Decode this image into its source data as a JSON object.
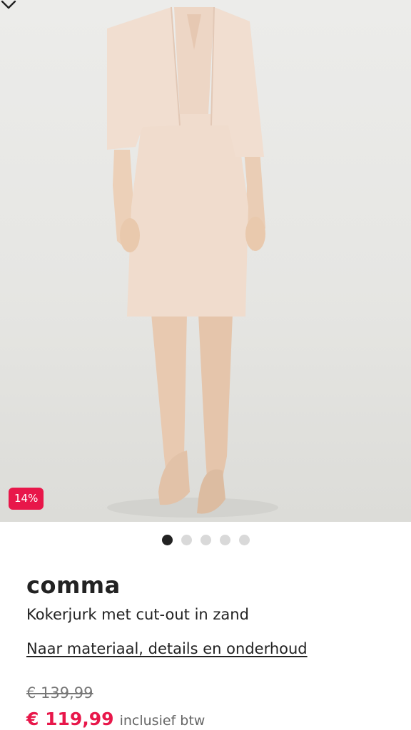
{
  "gallery": {
    "discount_badge": "14%",
    "dot_count": 5,
    "active_dot": 0
  },
  "product": {
    "brand": "comma",
    "title": "Kokerjurk met cut-out in zand",
    "details_link": "Naar materiaal, details en onderhoud",
    "old_price": "€ 139,99",
    "price": "€ 119,99",
    "price_note": "inclusief btw"
  },
  "colors": {
    "accent": "#e8174a",
    "dot_inactive": "#d9d9d9",
    "dot_active": "#222222"
  },
  "icons": {
    "collapse": "chevron-down-icon"
  }
}
